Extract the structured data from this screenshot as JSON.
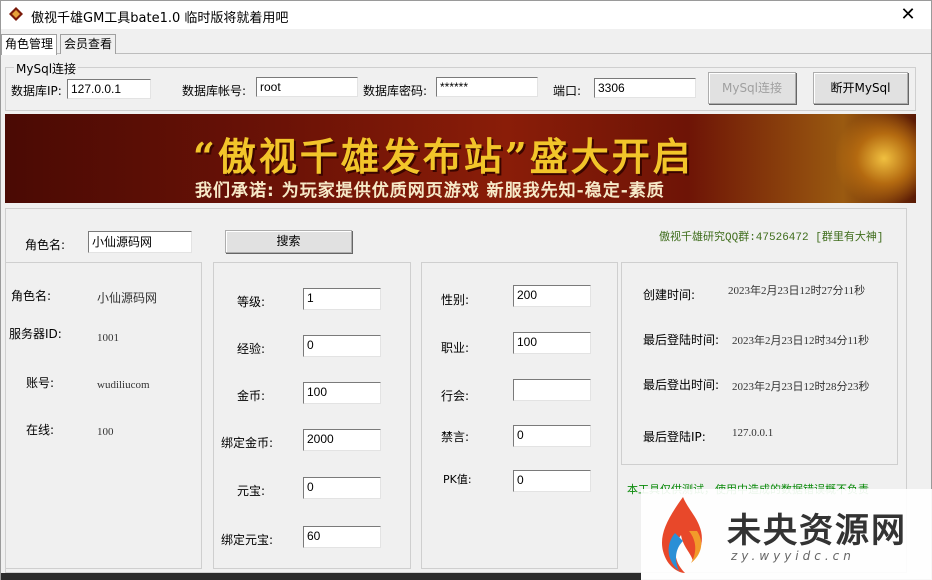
{
  "window": {
    "title": "傲视千雄GM工具bate1.0 临时版将就着用吧",
    "close_glyph": "✕"
  },
  "tabs": [
    {
      "label": "角色管理"
    },
    {
      "label": "会员查看"
    }
  ],
  "mysql": {
    "legend": "MySql连接",
    "ip_label": "数据库IP:",
    "ip_value": "127.0.0.1",
    "user_label": "数据库帐号:",
    "user_value": "root",
    "pwd_label": "数据库密码:",
    "pwd_value": "******",
    "port_label": "端口:",
    "port_value": "3306",
    "connect_label": "MySql连接",
    "disconnect_label": "断开MySql"
  },
  "banner": {
    "title": "“傲视千雄发布站”盛大开启",
    "subtitle": "我们承诺: 为玩家提供优质网页游戏 新服我先知-稳定-素质"
  },
  "search": {
    "label": "角色名:",
    "value": "小仙源码网",
    "button_label": "搜索",
    "qq_text": "傲视千雄研究QQ群:47526472 [群里有大神]"
  },
  "info": {
    "name_label": "角色名:",
    "name_value": "小仙源码网",
    "server_label": "服务器ID:",
    "server_value": "1001",
    "account_label": "账号:",
    "account_value": "wudiliucom",
    "online_label": "在线:",
    "online_value": "100"
  },
  "stats": {
    "level_label": "等级:",
    "level_value": "1",
    "exp_label": "经验:",
    "exp_value": "0",
    "gold_label": "金币:",
    "gold_value": "100",
    "bound_gold_label": "绑定金币:",
    "bound_gold_value": "2000",
    "yuanbao_label": "元宝:",
    "yuanbao_value": "0",
    "bound_yuanbao_label": "绑定元宝:",
    "bound_yuanbao_value": "60"
  },
  "attrs": {
    "gender_label": "性别:",
    "gender_value": "200",
    "job_label": "职业:",
    "job_value": "100",
    "guild_label": "行会:",
    "guild_value": "",
    "mute_label": "禁言:",
    "mute_value": "0",
    "pk_label": "PK值:",
    "pk_value": "0"
  },
  "times": {
    "created_label": "创建时间:",
    "created_value": "2023年2月23日12时27分11秒",
    "last_login_label": "最后登陆时间:",
    "last_login_value": "2023年2月23日12时34分11秒",
    "last_logout_label": "最后登出时间:",
    "last_logout_value": "2023年2月23日12时28分23秒",
    "last_ip_label": "最后登陆IP:",
    "last_ip_value": "127.0.0.1"
  },
  "notice": "本工具仅供测试，使用中造成的数据错误概不负责",
  "watermark": {
    "text": "未央资源网",
    "url": "zy.wyyidc.cn"
  }
}
